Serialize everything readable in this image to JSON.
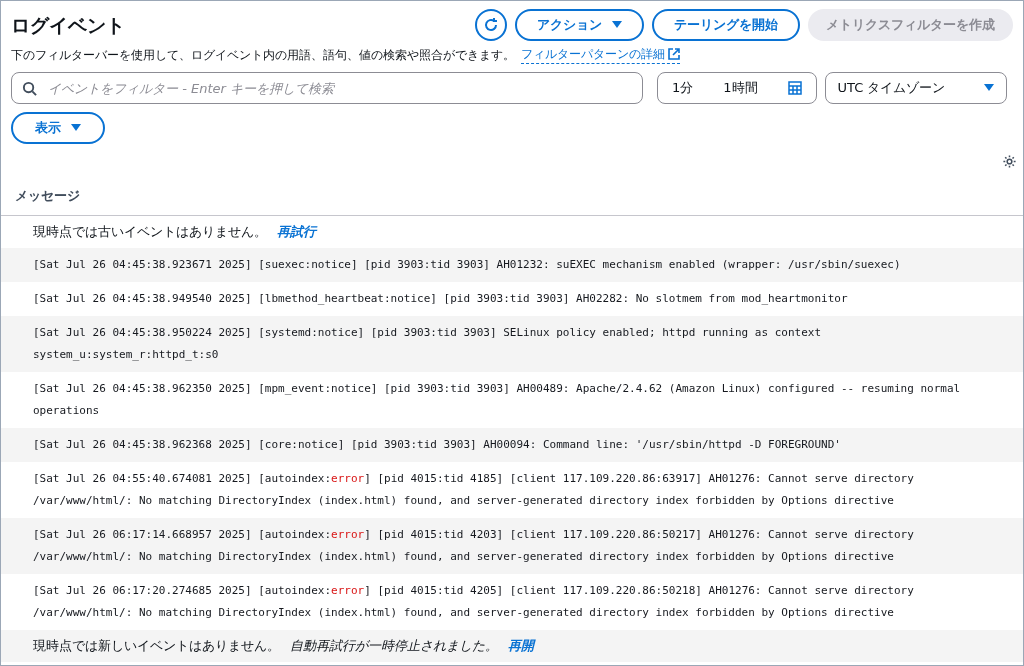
{
  "header": {
    "title": "ログイベント",
    "buttons": [
      {
        "label": "アクション",
        "kind": "dropdown",
        "disabled": false
      },
      {
        "label": "テーリングを開始",
        "kind": "plain",
        "disabled": false
      },
      {
        "label": "メトリクスフィルターを作成",
        "kind": "plain",
        "disabled": true
      }
    ]
  },
  "description": {
    "text": "下のフィルターバーを使用して、ログイベント内の用語、語句、値の検索や照合ができます。",
    "link": "フィルターパターンの詳細"
  },
  "filter": {
    "placeholder": "イベントをフィルター - Enter キーを押して検索",
    "ranges": [
      "1分",
      "1時間"
    ],
    "timezone": "UTC タイムゾーン"
  },
  "display_button": "表示",
  "table": {
    "column": "メッセージ",
    "top_notice": {
      "text": "現時点では古いイベントはありません。",
      "link": "再試行"
    },
    "rows": [
      {
        "parts": [
          {
            "kind": "plain",
            "text": "[Sat Jul 26 04:45:38.923671 2025] [suexec:notice] [pid 3903:tid 3903] AH01232: suEXEC mechanism enabled (wrapper: /usr/sbin/suexec)"
          }
        ]
      },
      {
        "parts": [
          {
            "kind": "plain",
            "text": "[Sat Jul 26 04:45:38.949540 2025] [lbmethod_heartbeat:notice] [pid 3903:tid 3903] AH02282: No slotmem from mod_heartmonitor"
          }
        ]
      },
      {
        "parts": [
          {
            "kind": "plain",
            "text": "[Sat Jul 26 04:45:38.950224 2025] [systemd:notice] [pid 3903:tid 3903] SELinux policy enabled; httpd running as context system_u:system_r:httpd_t:s0"
          }
        ]
      },
      {
        "parts": [
          {
            "kind": "plain",
            "text": "[Sat Jul 26 04:45:38.962350 2025] [mpm_event:notice] [pid 3903:tid 3903] AH00489: Apache/2.4.62 (Amazon Linux) configured -- resuming normal operations"
          }
        ]
      },
      {
        "parts": [
          {
            "kind": "plain",
            "text": "[Sat Jul 26 04:45:38.962368 2025] [core:notice] [pid 3903:tid 3903] AH00094: Command line: '/usr/sbin/httpd -D FOREGROUND'"
          }
        ]
      },
      {
        "parts": [
          {
            "kind": "plain",
            "text": "[Sat Jul 26 04:55:40.674081 2025] [autoindex:"
          },
          {
            "kind": "error",
            "text": "error"
          },
          {
            "kind": "plain",
            "text": "] [pid 4015:tid 4185] [client 117.109.220.86:63917] AH01276: Cannot serve directory /var/www/html/: No matching DirectoryIndex (index.html) found, and server-generated directory index forbidden by Options directive"
          }
        ]
      },
      {
        "parts": [
          {
            "kind": "plain",
            "text": "[Sat Jul 26 06:17:14.668957 2025] [autoindex:"
          },
          {
            "kind": "error",
            "text": "error"
          },
          {
            "kind": "plain",
            "text": "] [pid 4015:tid 4203] [client 117.109.220.86:50217] AH01276: Cannot serve directory /var/www/html/: No matching DirectoryIndex (index.html) found, and server-generated directory index forbidden by Options directive"
          }
        ]
      },
      {
        "parts": [
          {
            "kind": "plain",
            "text": "[Sat Jul 26 06:17:20.274685 2025] [autoindex:"
          },
          {
            "kind": "error",
            "text": "error"
          },
          {
            "kind": "plain",
            "text": "] [pid 4015:tid 4205] [client 117.109.220.86:50218] AH01276: Cannot serve directory /var/www/html/: No matching DirectoryIndex (index.html) found, and server-generated directory index forbidden by Options directive"
          }
        ]
      }
    ],
    "bottom_notice": {
      "text": "現時点では新しいイベントはありません。",
      "note": "自動再試行が一時停止されました。",
      "link": "再開"
    }
  }
}
